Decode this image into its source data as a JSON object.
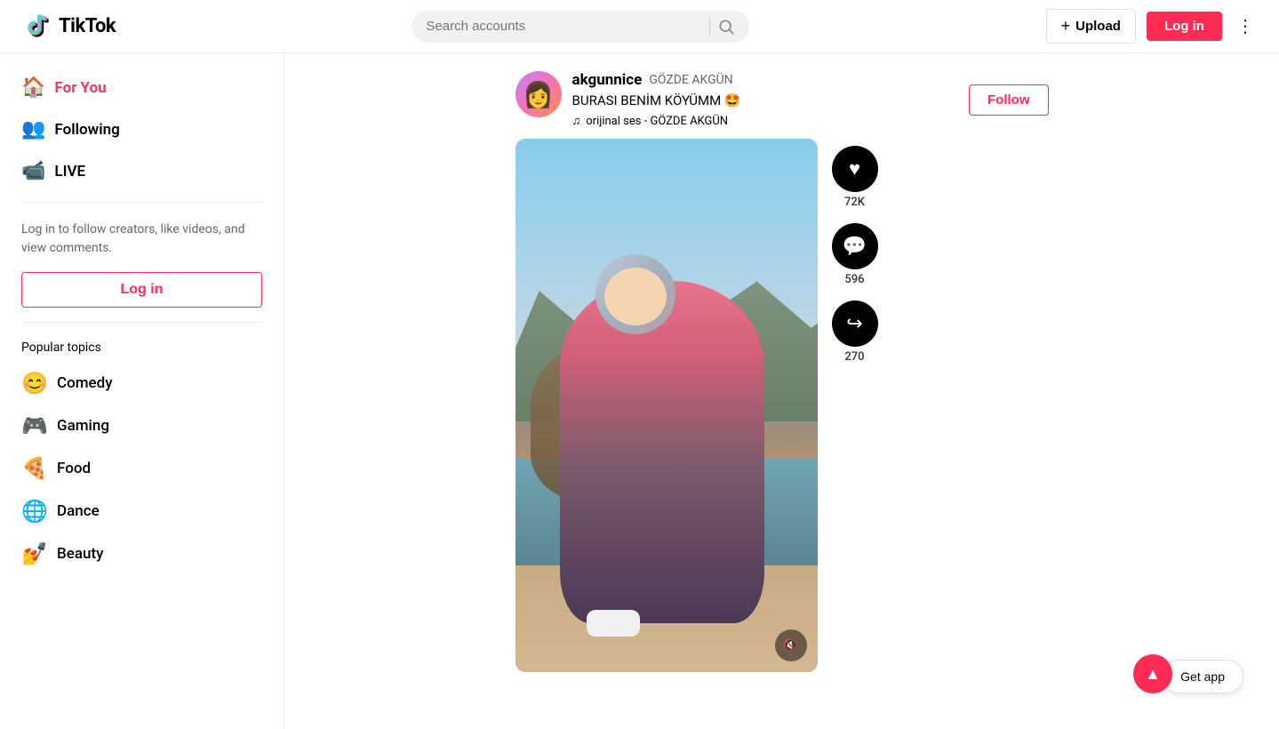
{
  "header": {
    "logo_text": "TikTok",
    "search_placeholder": "Search accounts",
    "upload_label": "Upload",
    "login_label": "Log in",
    "more_label": "⋮"
  },
  "sidebar": {
    "nav_items": [
      {
        "id": "for-you",
        "label": "For You",
        "icon": "🏠",
        "active": true
      },
      {
        "id": "following",
        "label": "Following",
        "icon": "👥",
        "active": false
      },
      {
        "id": "live",
        "label": "LIVE",
        "icon": "📹",
        "active": false
      }
    ],
    "login_prompt": "Log in to follow creators, like videos, and view comments.",
    "login_btn_label": "Log in",
    "popular_topics_label": "Popular topics",
    "topics": [
      {
        "id": "comedy",
        "label": "Comedy",
        "icon": "😊"
      },
      {
        "id": "gaming",
        "label": "Gaming",
        "icon": "🎮"
      },
      {
        "id": "food",
        "label": "Food",
        "icon": "🍕"
      },
      {
        "id": "dance",
        "label": "Dance",
        "icon": "🌐"
      },
      {
        "id": "beauty",
        "label": "Beauty",
        "icon": "💅"
      }
    ]
  },
  "post": {
    "username": "akgunnice",
    "display_name": "GÖZDE AKGÜN",
    "caption": "BURASI BENİM KÖYÜMM 🤩",
    "music": "orijinal ses - GÖZDE AKGÜN",
    "follow_label": "Follow",
    "stats": {
      "likes": "72K",
      "comments": "596",
      "shares": "270"
    }
  },
  "get_app_label": "Get app",
  "colors": {
    "brand": "#fe2c55",
    "accent": "#fe2c55"
  }
}
